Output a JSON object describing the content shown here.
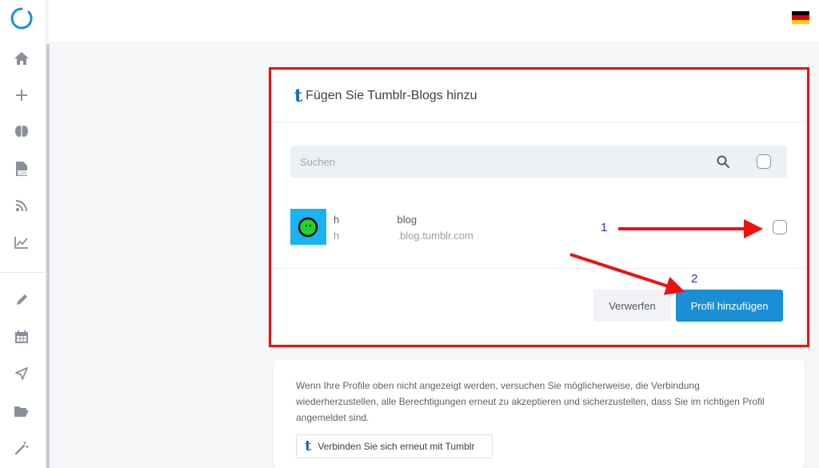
{
  "topbar": {
    "language_flag": "de-flag-icon"
  },
  "sidebar": {
    "items": [
      {
        "name": "home-icon"
      },
      {
        "name": "plus-icon"
      },
      {
        "name": "brain-icon"
      },
      {
        "name": "csv-file-icon"
      },
      {
        "name": "rss-icon"
      },
      {
        "name": "chart-line-icon"
      },
      {
        "name": "pencil-icon"
      },
      {
        "name": "calendar-icon"
      },
      {
        "name": "send-icon"
      },
      {
        "name": "folder-open-icon"
      },
      {
        "name": "magic-wand-icon"
      }
    ]
  },
  "modal": {
    "title": "Fügen Sie Tumblr-Blogs hinzu",
    "tumblr_glyph": "t",
    "search": {
      "placeholder": "Suchen"
    },
    "blog": {
      "name": "h                    blog",
      "url": "h                    .blog.tumblr.com"
    },
    "discard_label": "Verwerfen",
    "add_label": "Profil hinzufügen"
  },
  "annotations": {
    "one": "1",
    "two": "2",
    "color": "#ee1111",
    "number_color": "#2b2bde"
  },
  "info": {
    "text": "Wenn Ihre Profile oben nicht angezeigt werden, versuchen Sie möglicherweise, die Verbindung wiederherzustellen, alle Berechtigungen erneut zu akzeptieren und sicherzustellen, dass Sie im richtigen Profil angemeldet sind.",
    "reconnect_label": "Verbinden Sie sich erneut mit Tumblr"
  },
  "colors": {
    "accent": "#1b8fd6",
    "tumblr": "#1a6aab",
    "highlight": "#ee1111"
  }
}
